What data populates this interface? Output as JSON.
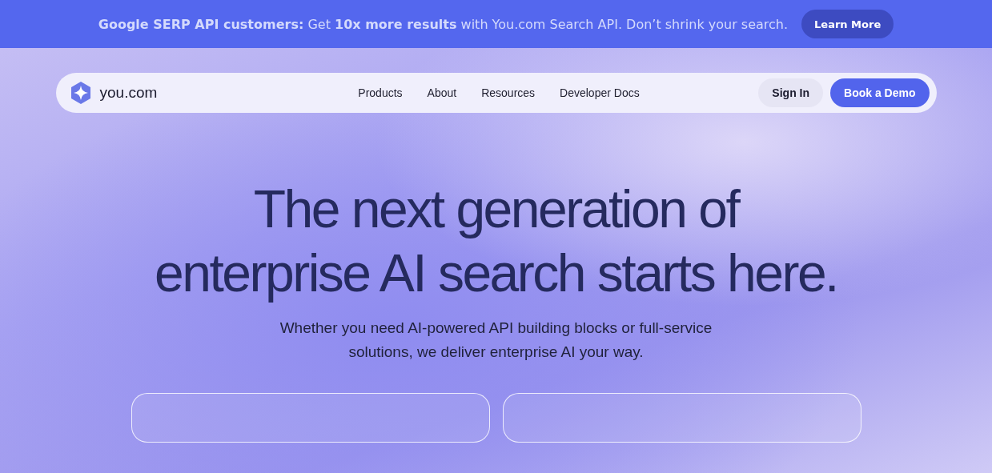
{
  "banner": {
    "message": "**Google SERP API customers:** Get **10x more results** with You.com Search API. Don’t shrink your search.",
    "button": "Learn More"
  },
  "nav": {
    "logo": "you.com",
    "links": [
      "Products",
      "About",
      "Resources",
      "Developer Docs"
    ],
    "sign_in": "Sign In",
    "cta": "Book a Demo"
  },
  "hero": {
    "title": "The next generation of enterprise AI search starts here.",
    "subtitle": "Whether you need AI-powered API building blocks or full-service solutions, we deliver enterprise AI your way."
  },
  "cards": [
    {
      "kind": "card"
    },
    {
      "kind": "card"
    }
  ]
}
